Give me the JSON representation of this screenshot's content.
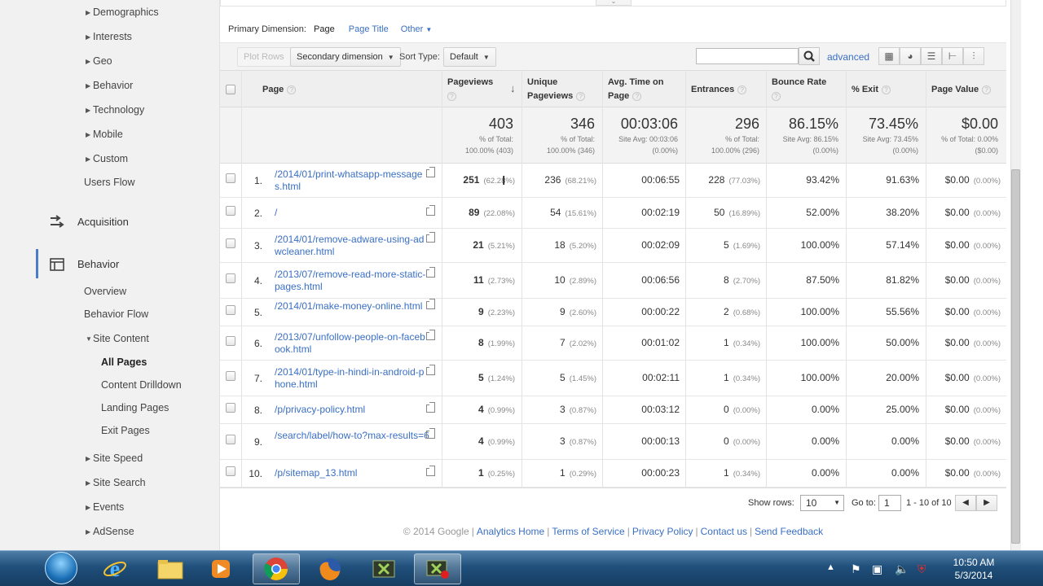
{
  "sidebar": {
    "audience_items": [
      {
        "label": "Demographics"
      },
      {
        "label": "Interests"
      },
      {
        "label": "Geo"
      },
      {
        "label": "Behavior"
      },
      {
        "label": "Technology"
      },
      {
        "label": "Mobile"
      },
      {
        "label": "Custom"
      }
    ],
    "users_flow": "Users Flow",
    "acquisition": "Acquisition",
    "behavior": "Behavior",
    "behavior_items": {
      "overview": "Overview",
      "behavior_flow": "Behavior Flow",
      "site_content": "Site Content",
      "all_pages": "All Pages",
      "content_drilldown": "Content Drilldown",
      "landing_pages": "Landing Pages",
      "exit_pages": "Exit Pages",
      "site_speed": "Site Speed",
      "site_search": "Site Search",
      "events": "Events",
      "adsense": "AdSense"
    }
  },
  "dimension_bar": {
    "label": "Primary Dimension:",
    "current": "Page",
    "page_title": "Page Title",
    "other": "Other"
  },
  "toolbar": {
    "plot_rows": "Plot Rows",
    "secondary_dimension": "Secondary dimension",
    "sort_type_label": "Sort Type:",
    "sort_type_value": "Default",
    "search_placeholder": "",
    "advanced": "advanced",
    "view_icons": [
      "grid-view-icon",
      "pie-view-icon",
      "bar-view-icon",
      "comparison-view-icon",
      "pivot-view-icon"
    ]
  },
  "table": {
    "headers": {
      "page": "Page",
      "pageviews": "Pageviews",
      "unique_pageviews_1": "Unique",
      "unique_pageviews_2": "Pageviews",
      "avg_time_1": "Avg. Time on",
      "avg_time_2": "Page",
      "entrances": "Entrances",
      "bounce_rate": "Bounce Rate",
      "exit": "% Exit",
      "page_value": "Page Value"
    },
    "totals": {
      "pageviews": {
        "value": "403",
        "sub1": "% of Total:",
        "sub2": "100.00% (403)"
      },
      "unique": {
        "value": "346",
        "sub1": "% of Total:",
        "sub2": "100.00% (346)"
      },
      "avg_time": {
        "value": "00:03:06",
        "sub1": "Site Avg: 00:03:06",
        "sub2": "(0.00%)"
      },
      "entrances": {
        "value": "296",
        "sub1": "% of Total:",
        "sub2": "100.00% (296)"
      },
      "bounce": {
        "value": "86.15%",
        "sub1": "Site Avg: 86.15%",
        "sub2": "(0.00%)"
      },
      "exit": {
        "value": "73.45%",
        "sub1": "Site Avg: 73.45%",
        "sub2": "(0.00%)"
      },
      "page_value": {
        "value": "$0.00",
        "sub1": "% of Total: 0.00%",
        "sub2": "($0.00)"
      }
    },
    "rows": [
      {
        "idx": "1.",
        "page": "/2014/01/print-whatsapp-messages.html",
        "pv": "251",
        "pv_pct": "(62.28%)",
        "upv": "236",
        "upv_pct": "(68.21%)",
        "time": "00:06:55",
        "ent": "228",
        "ent_pct": "(77.03%)",
        "bounce": "93.42%",
        "exit": "91.63%",
        "value": "$0.00",
        "value_pct": "(0.00%)"
      },
      {
        "idx": "2.",
        "page": "/",
        "pv": "89",
        "pv_pct": "(22.08%)",
        "upv": "54",
        "upv_pct": "(15.61%)",
        "time": "00:02:19",
        "ent": "50",
        "ent_pct": "(16.89%)",
        "bounce": "52.00%",
        "exit": "38.20%",
        "value": "$0.00",
        "value_pct": "(0.00%)"
      },
      {
        "idx": "3.",
        "page": "/2014/01/remove-adware-using-adwcleaner.html",
        "pv": "21",
        "pv_pct": "(5.21%)",
        "upv": "18",
        "upv_pct": "(5.20%)",
        "time": "00:02:09",
        "ent": "5",
        "ent_pct": "(1.69%)",
        "bounce": "100.00%",
        "exit": "57.14%",
        "value": "$0.00",
        "value_pct": "(0.00%)"
      },
      {
        "idx": "4.",
        "page": "/2013/07/remove-read-more-static-pages.html",
        "pv": "11",
        "pv_pct": "(2.73%)",
        "upv": "10",
        "upv_pct": "(2.89%)",
        "time": "00:06:56",
        "ent": "8",
        "ent_pct": "(2.70%)",
        "bounce": "87.50%",
        "exit": "81.82%",
        "value": "$0.00",
        "value_pct": "(0.00%)"
      },
      {
        "idx": "5.",
        "page": "/2014/01/make-money-online.html",
        "pv": "9",
        "pv_pct": "(2.23%)",
        "upv": "9",
        "upv_pct": "(2.60%)",
        "time": "00:00:22",
        "ent": "2",
        "ent_pct": "(0.68%)",
        "bounce": "100.00%",
        "exit": "55.56%",
        "value": "$0.00",
        "value_pct": "(0.00%)"
      },
      {
        "idx": "6.",
        "page": "/2013/07/unfollow-people-on-facebook.html",
        "pv": "8",
        "pv_pct": "(1.99%)",
        "upv": "7",
        "upv_pct": "(2.02%)",
        "time": "00:01:02",
        "ent": "1",
        "ent_pct": "(0.34%)",
        "bounce": "100.00%",
        "exit": "50.00%",
        "value": "$0.00",
        "value_pct": "(0.00%)"
      },
      {
        "idx": "7.",
        "page": "/2014/01/type-in-hindi-in-android-phone.html",
        "pv": "5",
        "pv_pct": "(1.24%)",
        "upv": "5",
        "upv_pct": "(1.45%)",
        "time": "00:02:11",
        "ent": "1",
        "ent_pct": "(0.34%)",
        "bounce": "100.00%",
        "exit": "20.00%",
        "value": "$0.00",
        "value_pct": "(0.00%)"
      },
      {
        "idx": "8.",
        "page": "/p/privacy-policy.html",
        "pv": "4",
        "pv_pct": "(0.99%)",
        "upv": "3",
        "upv_pct": "(0.87%)",
        "time": "00:03:12",
        "ent": "0",
        "ent_pct": "(0.00%)",
        "bounce": "0.00%",
        "exit": "25.00%",
        "value": "$0.00",
        "value_pct": "(0.00%)"
      },
      {
        "idx": "9.",
        "page": "/search/label/how-to?max-results=6",
        "pv": "4",
        "pv_pct": "(0.99%)",
        "upv": "3",
        "upv_pct": "(0.87%)",
        "time": "00:00:13",
        "ent": "0",
        "ent_pct": "(0.00%)",
        "bounce": "0.00%",
        "exit": "0.00%",
        "value": "$0.00",
        "value_pct": "(0.00%)"
      },
      {
        "idx": "10.",
        "page": "/p/sitemap_13.html",
        "pv": "1",
        "pv_pct": "(0.25%)",
        "upv": "1",
        "upv_pct": "(0.29%)",
        "time": "00:00:23",
        "ent": "1",
        "ent_pct": "(0.34%)",
        "bounce": "0.00%",
        "exit": "0.00%",
        "value": "$0.00",
        "value_pct": "(0.00%)"
      }
    ]
  },
  "pagination": {
    "show_rows_label": "Show rows:",
    "show_rows_value": "10",
    "goto_label": "Go to:",
    "goto_value": "1",
    "range": "1 - 10 of 10"
  },
  "footer": {
    "copyright": "© 2014 Google",
    "links": [
      "Analytics Home",
      "Terms of Service",
      "Privacy Policy",
      "Contact us",
      "Send Feedback"
    ]
  },
  "taskbar": {
    "time": "10:50 AM",
    "date": "5/3/2014",
    "apps": [
      "start-orb-icon",
      "internet-explorer-icon",
      "file-explorer-icon",
      "media-player-icon",
      "chrome-icon",
      "firefox-icon",
      "camtasia-icon",
      "camtasia-recorder-icon"
    ]
  },
  "colors": {
    "link": "#3a6fc4",
    "sidebar_bg": "#f1f1f1",
    "active_marker": "#4a7ccc",
    "taskbar": "#1f4f7a"
  }
}
